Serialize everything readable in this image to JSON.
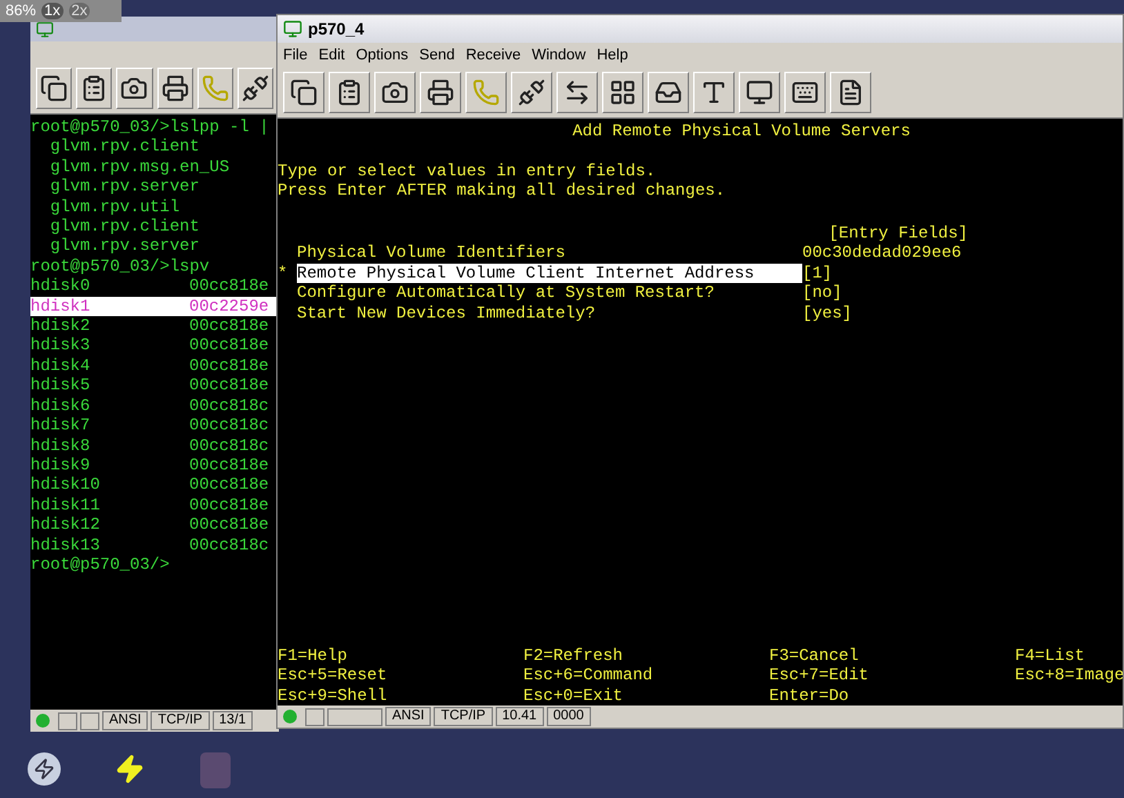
{
  "viewer": {
    "zoom": "86%",
    "buttons": [
      {
        "label": "1x",
        "selected": true
      },
      {
        "label": "2x",
        "selected": false
      }
    ]
  },
  "left_window": {
    "terminal": {
      "lines": [
        "root@p570_03/>lslpp -l |",
        "  glvm.rpv.client",
        "  glvm.rpv.msg.en_US",
        "  glvm.rpv.server",
        "  glvm.rpv.util",
        "  glvm.rpv.client",
        "  glvm.rpv.server",
        "root@p570_03/>lspv"
      ],
      "disks": [
        {
          "name": "hdisk0",
          "id": "00cc818e",
          "selected": false
        },
        {
          "name": "hdisk1",
          "id": "00c2259e",
          "selected": true
        },
        {
          "name": "hdisk2",
          "id": "00cc818e",
          "selected": false
        },
        {
          "name": "hdisk3",
          "id": "00cc818e",
          "selected": false
        },
        {
          "name": "hdisk4",
          "id": "00cc818e",
          "selected": false
        },
        {
          "name": "hdisk5",
          "id": "00cc818e",
          "selected": false
        },
        {
          "name": "hdisk6",
          "id": "00cc818c",
          "selected": false
        },
        {
          "name": "hdisk7",
          "id": "00cc818c",
          "selected": false
        },
        {
          "name": "hdisk8",
          "id": "00cc818c",
          "selected": false
        },
        {
          "name": "hdisk9",
          "id": "00cc818e",
          "selected": false
        },
        {
          "name": "hdisk10",
          "id": "00cc818e",
          "selected": false
        },
        {
          "name": "hdisk11",
          "id": "00cc818e",
          "selected": false
        },
        {
          "name": "hdisk12",
          "id": "00cc818e",
          "selected": false
        },
        {
          "name": "hdisk13",
          "id": "00cc818c",
          "selected": false
        }
      ],
      "prompt": "root@p570_03/>"
    },
    "status_bar": [
      "ANSI",
      "TCP/IP",
      "13/1"
    ]
  },
  "right_window": {
    "title": "p570_4",
    "menu": [
      "File",
      "Edit",
      "Options",
      "Send",
      "Receive",
      "Window",
      "Help"
    ],
    "terminal": {
      "heading": "Add Remote Physical Volume Servers",
      "instructions": [
        "Type or select values in entry fields.",
        "Press Enter AFTER making all desired changes."
      ],
      "column_header": "[Entry Fields]",
      "fields": [
        {
          "label": "Physical Volume Identifiers",
          "value": "00c30dedad029ee6",
          "selected": false
        },
        {
          "label": "Remote Physical Volume Client Internet Address",
          "value": "[1]",
          "marker": "*",
          "selected": true
        },
        {
          "label": "Configure Automatically at System Restart?",
          "value": "[no]",
          "selected": false
        },
        {
          "label": "Start New Devices Immediately?",
          "value": "[yes]",
          "selected": false
        }
      ],
      "keys": [
        [
          "F1=Help",
          "F2=Refresh",
          "F3=Cancel",
          "F4=List"
        ],
        [
          "Esc+5=Reset",
          "Esc+6=Command",
          "Esc+7=Edit",
          "Esc+8=Image"
        ],
        [
          "Esc+9=Shell",
          "Esc+0=Exit",
          "Enter=Do"
        ]
      ]
    },
    "status_bar": [
      "ANSI",
      "TCP/IP",
      "10.41",
      "0000"
    ]
  }
}
